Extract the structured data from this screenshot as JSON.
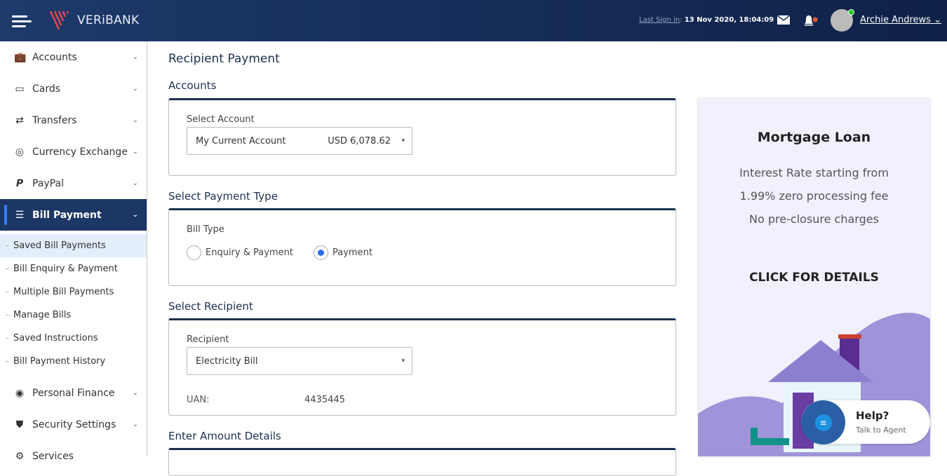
{
  "header": {
    "brand": "VERiBANK",
    "last_sign_label": "Last Sign in",
    "last_sign_value": "13 Nov 2020, 18:04:09",
    "user_name": "Archie Andrews",
    "avatar_text": "ACTIVE"
  },
  "sidebar": {
    "items": [
      {
        "label": "Accounts",
        "icon": "briefcase-icon"
      },
      {
        "label": "Cards",
        "icon": "card-icon"
      },
      {
        "label": "Transfers",
        "icon": "transfer-icon"
      },
      {
        "label": "Currency Exchange",
        "icon": "coins-icon"
      },
      {
        "label": "PayPal",
        "icon": "paypal-icon"
      },
      {
        "label": "Bill Payment",
        "icon": "bill-icon"
      }
    ],
    "sub_items": [
      "Saved Bill Payments",
      "Bill Enquiry & Payment",
      "Multiple Bill Payments",
      "Manage Bills",
      "Saved Instructions",
      "Bill Payment History"
    ],
    "items_after": [
      {
        "label": "Personal Finance",
        "icon": "target-icon"
      },
      {
        "label": "Security Settings",
        "icon": "shield-icon"
      },
      {
        "label": "Services",
        "icon": "gear-icon"
      }
    ]
  },
  "main": {
    "title": "Recipient Payment",
    "accounts": {
      "heading": "Accounts",
      "label": "Select Account",
      "account": "My Current Account",
      "balance": "USD 6,078.62"
    },
    "payment_type": {
      "heading": "Select Payment Type",
      "label": "Bill Type",
      "options": [
        "Enquiry & Payment",
        "Payment"
      ],
      "selected": "Payment"
    },
    "recipient": {
      "heading": "Select Recipient",
      "label": "Recipient",
      "value": "Electricity Bill",
      "uan_label": "UAN:",
      "uan_value": "4435445"
    },
    "amount": {
      "heading": "Enter Amount Details"
    }
  },
  "ad": {
    "title": "Mortgage Loan",
    "description": "Interest Rate starting from 1.99% zero processing fee No pre-closure charges",
    "cta": "CLICK FOR DETAILS"
  },
  "help": {
    "title": "Help?",
    "subtitle": "Talk to Agent"
  }
}
